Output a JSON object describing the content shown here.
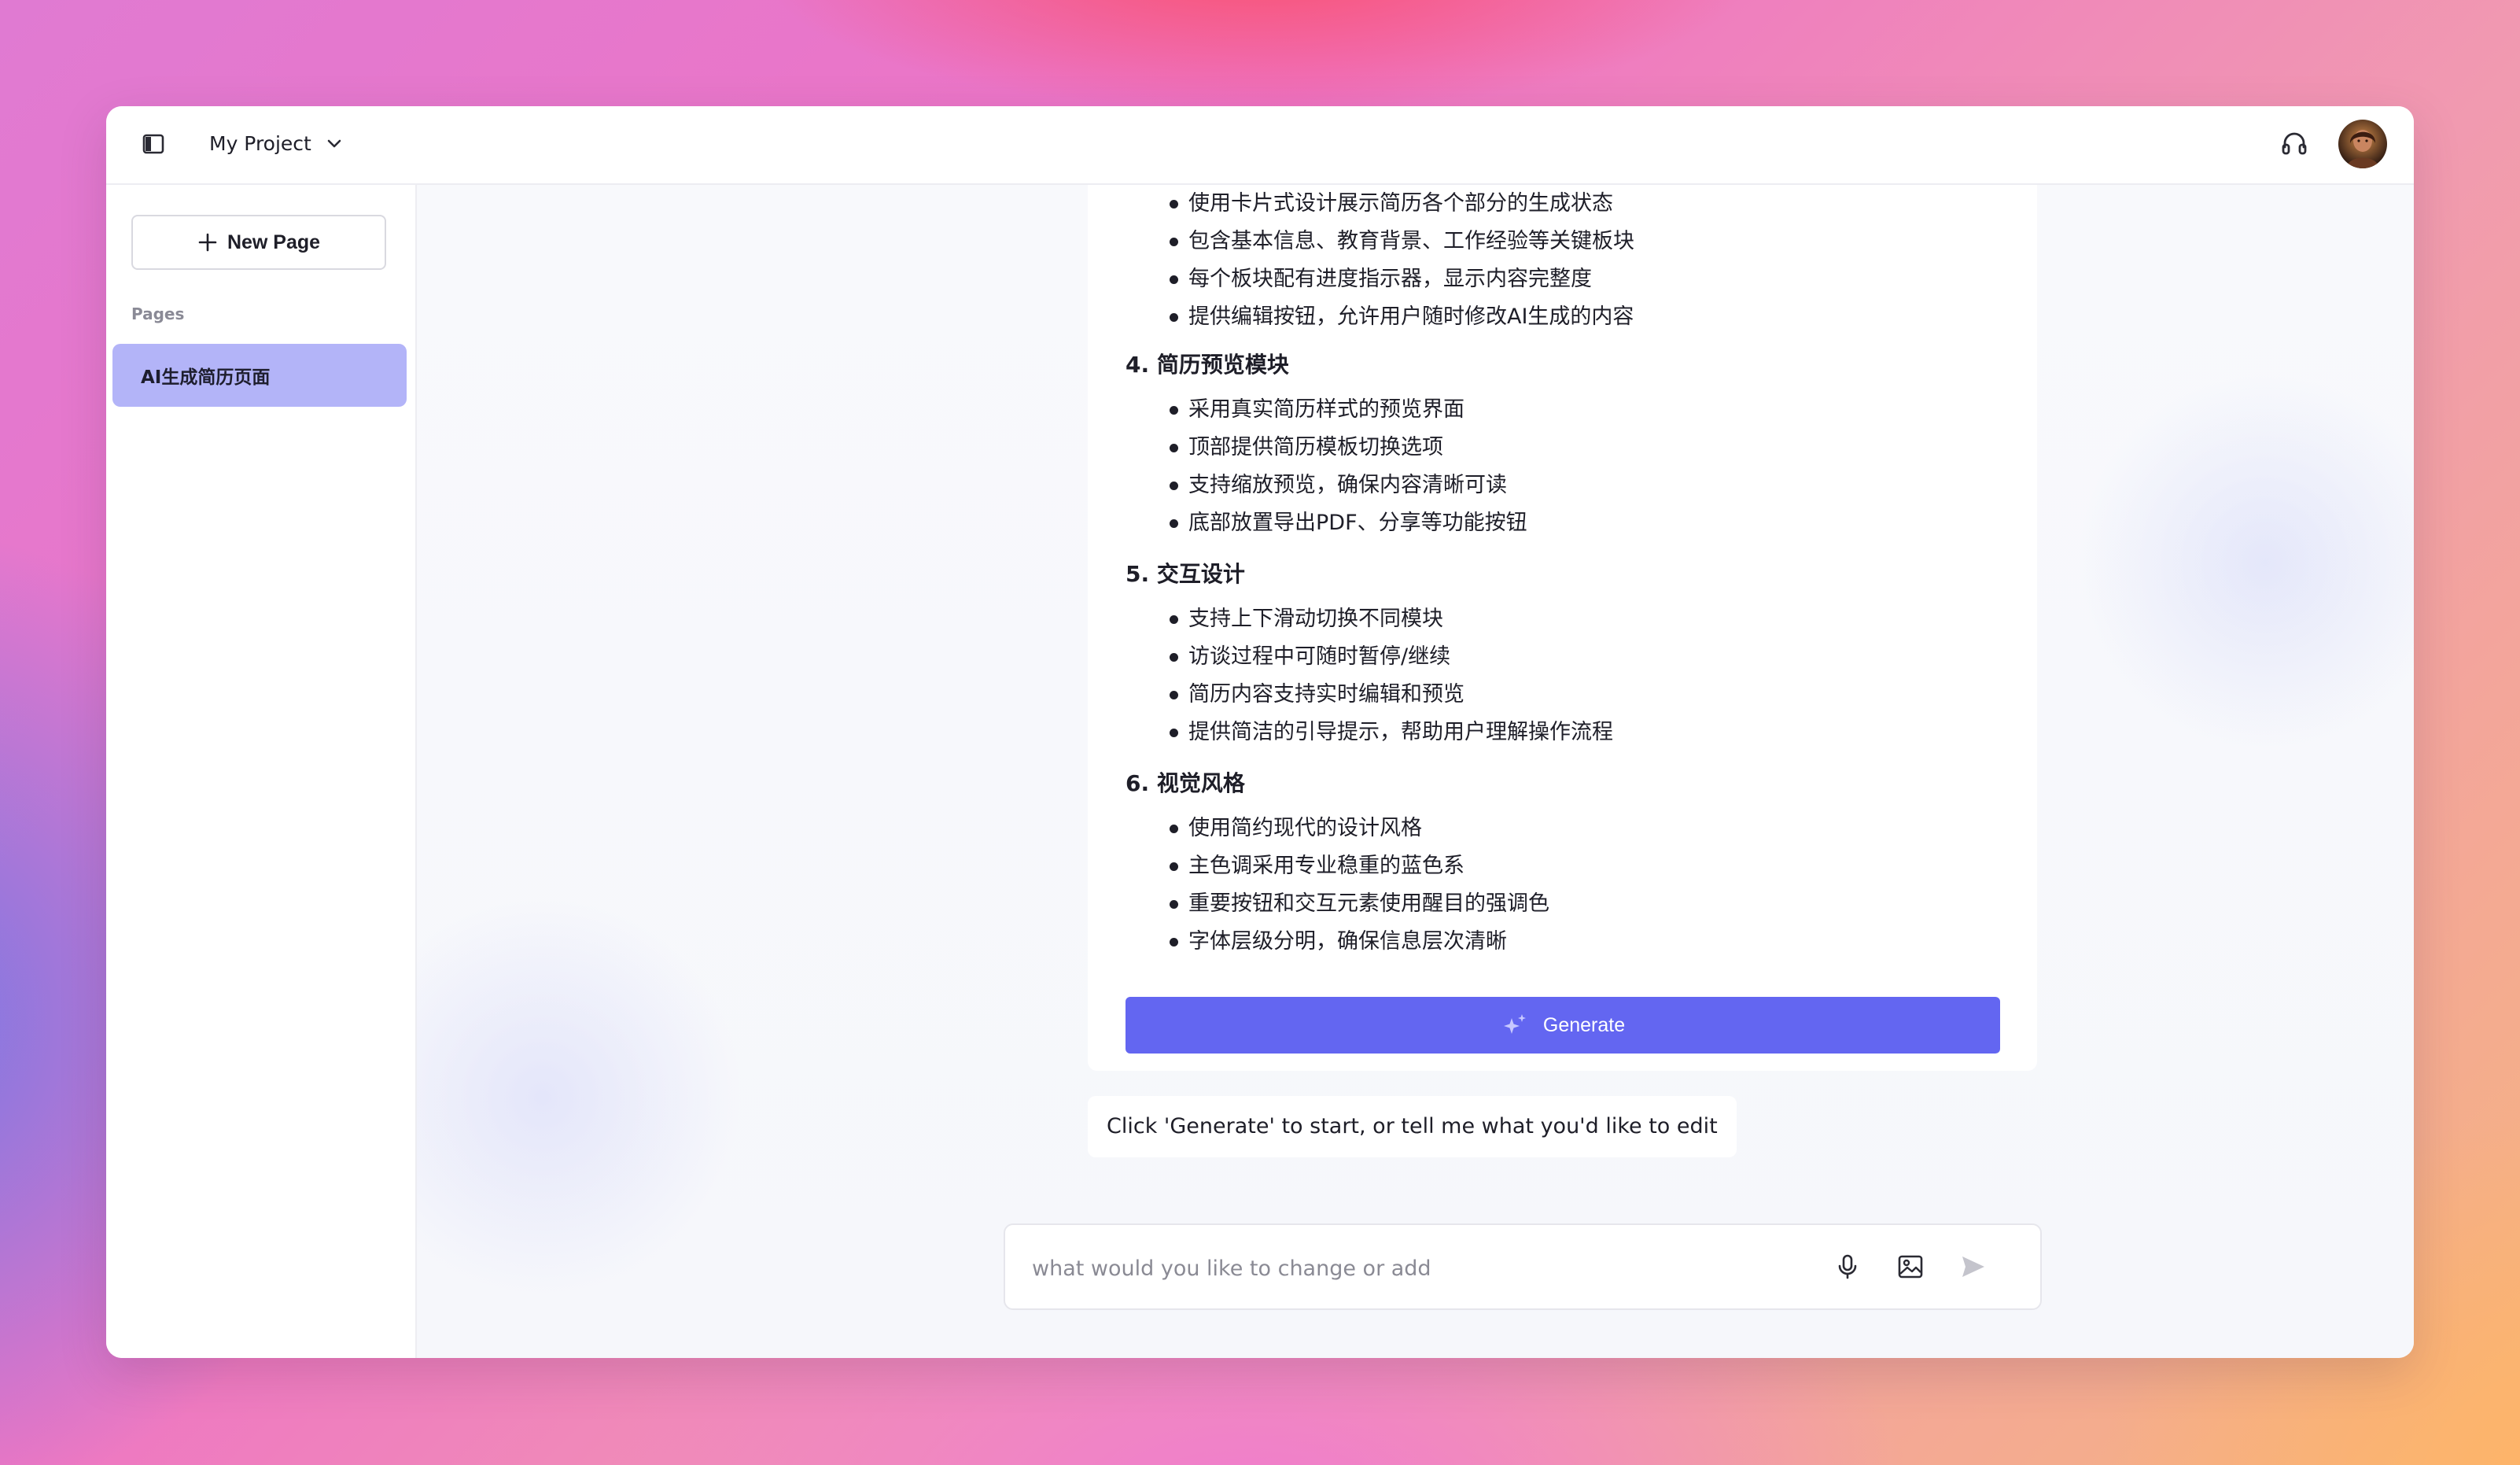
{
  "header": {
    "project_name": "My Project",
    "icons": {
      "sidebar_toggle": "sidebar-toggle-icon",
      "dropdown": "chevron-down-icon",
      "support": "headphones-icon",
      "avatar": "user-avatar"
    }
  },
  "sidebar": {
    "new_page_label": "New Page",
    "pages_label": "Pages",
    "pages": [
      {
        "label": "AI生成简历页面",
        "selected": true
      }
    ]
  },
  "main": {
    "plan": {
      "intro_items": [
        "使用卡片式设计展示简历各个部分的生成状态",
        "包含基本信息、教育背景、工作经验等关键板块",
        "每个板块配有进度指示器，显示内容完整度",
        "提供编辑按钮，允许用户随时修改AI生成的内容"
      ],
      "sections": [
        {
          "heading": "4. 简历预览模块",
          "items": [
            "采用真实简历样式的预览界面",
            "顶部提供简历模板切换选项",
            "支持缩放预览，确保内容清晰可读",
            "底部放置导出PDF、分享等功能按钮"
          ]
        },
        {
          "heading": "5. 交互设计",
          "items": [
            "支持上下滑动切换不同模块",
            "访谈过程中可随时暂停/继续",
            "简历内容支持实时编辑和预览",
            "提供简洁的引导提示，帮助用户理解操作流程"
          ]
        },
        {
          "heading": "6. 视觉风格",
          "items": [
            "使用简约现代的设计风格",
            "主色调采用专业稳重的蓝色系",
            "重要按钮和交互元素使用醒目的强调色",
            "字体层级分明，确保信息层次清晰"
          ]
        }
      ],
      "generate_label": "Generate"
    },
    "assistant_message": "Click 'Generate' to start, or tell me what you'd like to edit",
    "composer": {
      "placeholder": "what would you like to change or add",
      "value": ""
    }
  },
  "colors": {
    "accent": "#6366f1",
    "selected_page": "#b3b4f8",
    "text": "#1e1e28",
    "muted": "#8a8a96"
  }
}
